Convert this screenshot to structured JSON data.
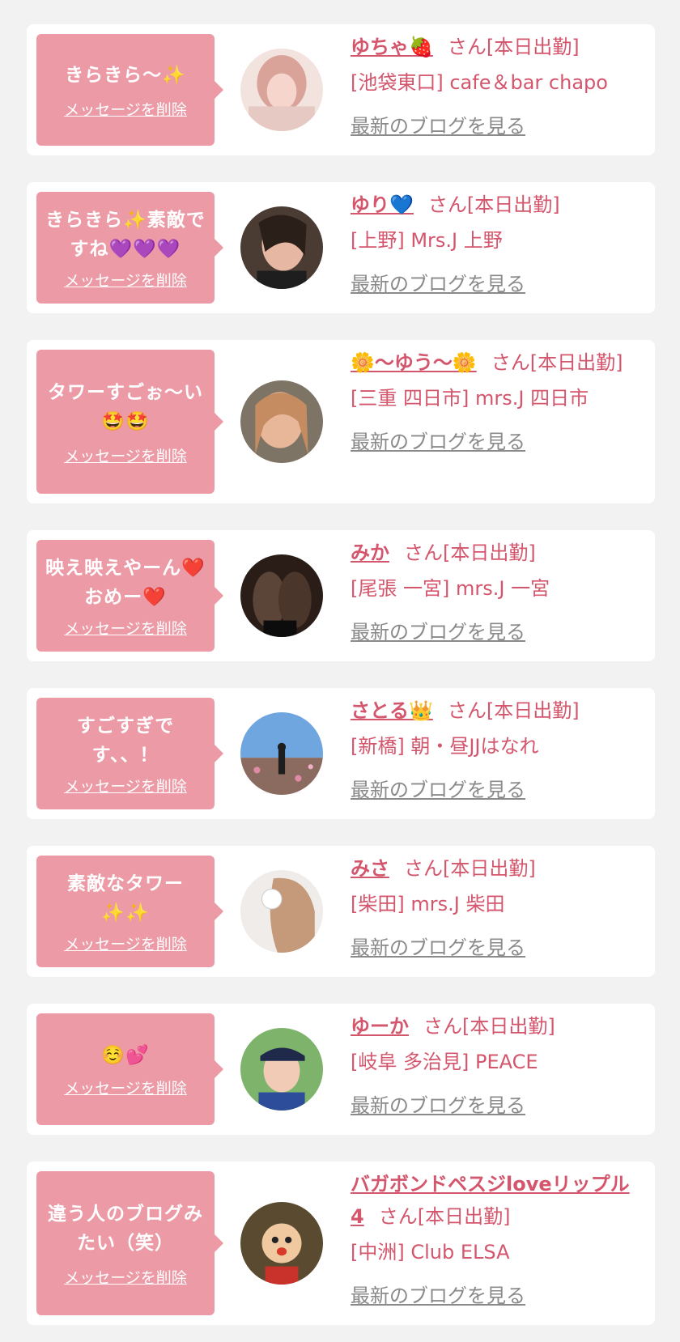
{
  "delete_label": "メッセージを削除",
  "blog_label": "最新のブログを見る",
  "suffix_label": "さん[本日出勤]",
  "colors": {
    "accent": "#d4566d",
    "bubble": "#ec9aa6",
    "link_gray": "#8a8a8a",
    "background": "#f2f2f2"
  },
  "items": [
    {
      "message": "きらきら〜✨",
      "name": "ゆちゃ🍓",
      "shop": "[池袋東口] cafe＆bar chapo"
    },
    {
      "message": "きらきら✨素敵ですね💜💜💜",
      "name": "ゆり💙",
      "shop": "[上野] Mrs.J 上野"
    },
    {
      "message": "タワーすごぉ〜い🤩🤩",
      "name": "🌼〜ゆう〜🌼",
      "shop": "[三重 四日市] mrs.J 四日市"
    },
    {
      "message": "映え映えやーん❤️おめー❤️",
      "name": "みか",
      "shop": "[尾張 一宮] mrs.J 一宮"
    },
    {
      "message": "すごすぎです、、！",
      "name": "さとる👑",
      "shop": "[新橋] 朝・昼JJはなれ"
    },
    {
      "message": "素敵なタワー✨✨",
      "name": "みさ",
      "shop": "[柴田] mrs.J 柴田"
    },
    {
      "message": "☺️💕",
      "name": "ゆーか",
      "shop": "[岐阜 多治見] PEACE"
    },
    {
      "message": "違う人のブログみたい（笑）",
      "name": "バガボンドペスジloveリップル4",
      "shop": "[中洲] Club ELSA"
    }
  ]
}
